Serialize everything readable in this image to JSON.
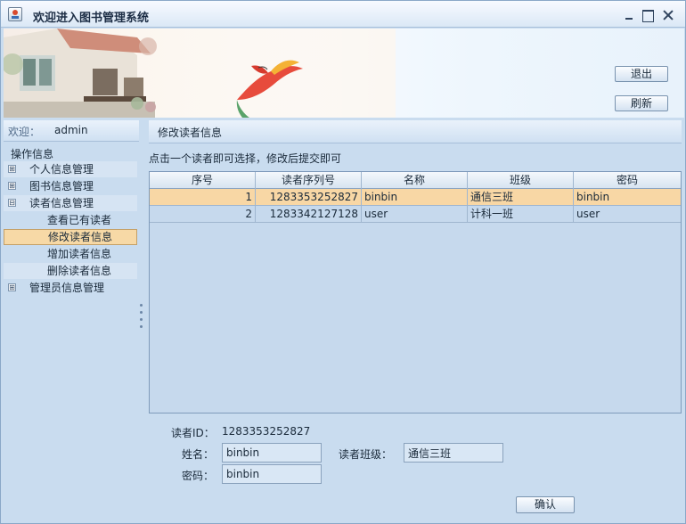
{
  "window": {
    "title": "欢迎进入图书管理系统",
    "controls": [
      "minimize-icon",
      "maximize-icon",
      "close-icon"
    ]
  },
  "banner": {
    "exit_label": "退出",
    "refresh_label": "刷新"
  },
  "welcome": {
    "label": "欢迎：",
    "user": "admin"
  },
  "tree": {
    "root": "操作信息",
    "items": [
      {
        "label": "个人信息管理",
        "toggle": "⊞"
      },
      {
        "label": "图书信息管理",
        "toggle": "⊞"
      },
      {
        "label": "读者信息管理",
        "toggle": "⊟"
      },
      {
        "label": "查看已有读者"
      },
      {
        "label": "修改读者信息"
      },
      {
        "label": "增加读者信息"
      },
      {
        "label": "删除读者信息"
      },
      {
        "label": "管理员信息管理",
        "toggle": "⊞"
      }
    ],
    "selected_index": 4
  },
  "panel": {
    "title": "修改读者信息",
    "hint": "点击一个读者即可选择，修改后提交即可"
  },
  "table": {
    "headers": [
      "序号",
      "读者序列号",
      "名称",
      "班级",
      "密码"
    ],
    "rows": [
      {
        "no": "1",
        "serial": "1283353252827",
        "name": "binbin",
        "class": "通信三班",
        "password": "binbin"
      },
      {
        "no": "2",
        "serial": "1283342127128",
        "name": "user",
        "class": "计科一班",
        "password": "user"
      }
    ],
    "selected_row": 0
  },
  "form": {
    "id_label": "读者ID：",
    "id_value": "1283353252827",
    "name_label": "姓名：",
    "name_value": "binbin",
    "class_label": "读者班级：",
    "class_value": "通信三班",
    "password_label": "密码：",
    "password_value": "binbin",
    "confirm_label": "确认"
  },
  "colors": {
    "window_bg": "#c9dcef",
    "selection": "#f8d7a5",
    "border": "#7f9bbb"
  }
}
